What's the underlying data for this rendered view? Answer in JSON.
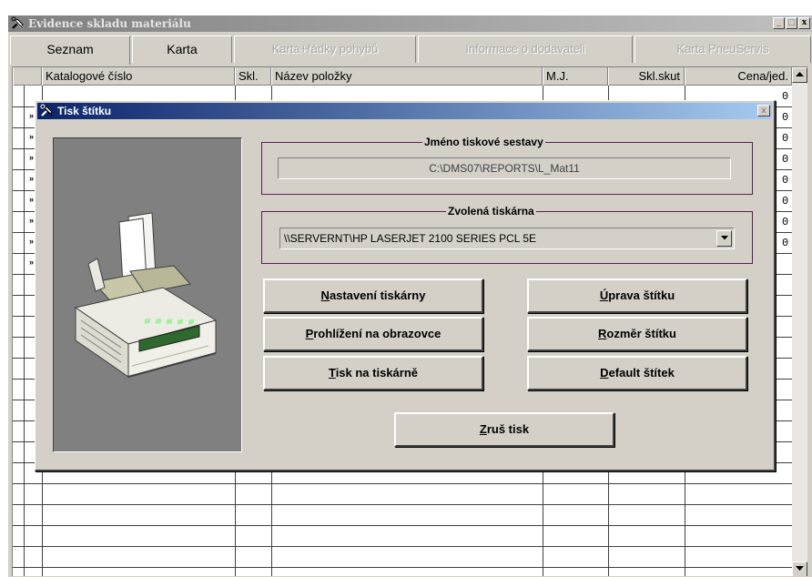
{
  "window": {
    "title": "Evidence skladu materiálu",
    "minimize_glyph": "_",
    "maximize_glyph": "□",
    "close_glyph": "x"
  },
  "tabs": [
    {
      "label": "Seznam",
      "state": "active"
    },
    {
      "label": "Karta",
      "state": "enabled"
    },
    {
      "label": "Karta+řádky pohybů",
      "state": "disabled"
    },
    {
      "label": "Informace o dodavateli",
      "state": "disabled"
    },
    {
      "label": "Karta PneuServis",
      "state": "disabled"
    }
  ],
  "grid": {
    "columns": [
      "Katalogové číslo",
      "Skl.",
      "Název položky",
      "M.J.",
      "Skl.skut",
      "Cena/jed."
    ],
    "row_marker": "»",
    "visible_values": [
      "0",
      "0",
      "0",
      "0",
      "0",
      "0",
      "0",
      "0"
    ]
  },
  "dialog": {
    "title": "Tisk štítku",
    "close_glyph": "x",
    "report_group_label": "Jméno tiskové sestavy",
    "report_path": "C:\\DMS07\\REPORTS\\L_Mat11",
    "printer_group_label": "Zvolená tiskárna",
    "printer_value": "\\\\SERVERNT\\HP LASERJET 2100 SERIES PCL 5E",
    "buttons": {
      "printer_setup": {
        "first": "N",
        "rest": "astavení tiskárny"
      },
      "preview": {
        "first": "P",
        "rest": "rohlížení na obrazovce"
      },
      "print": {
        "first": "T",
        "rest": "isk na tiskárně"
      },
      "edit_label": {
        "first": "Ú",
        "rest": "prava štítku"
      },
      "label_size": {
        "first": "R",
        "rest": "ozměr štítku"
      },
      "default_label": {
        "first": "D",
        "rest": "efault štítek"
      },
      "cancel_print": {
        "first": "Z",
        "rest": "ruš tisk"
      }
    }
  },
  "icons": {
    "app": "tools-icon",
    "printer": "laser-printer-illustration"
  },
  "colors": {
    "dialog_title_start": "#0a246a",
    "dialog_title_end": "#a6caf0",
    "inactive_title_start": "#808080",
    "groupbox_border": "#5a1e5a",
    "face": "#d4d0c8",
    "printer_panel": "#808080"
  }
}
